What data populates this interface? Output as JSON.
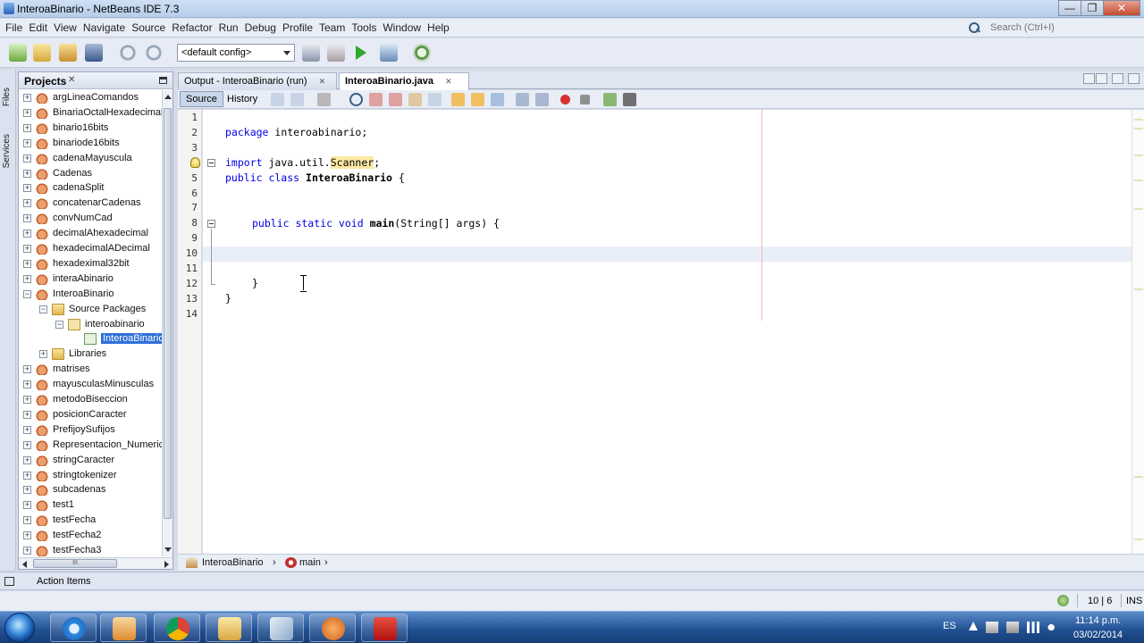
{
  "window": {
    "title": "InteroaBinario - NetBeans IDE 7.3",
    "controls": {
      "minimize": "—",
      "maximize": "❐",
      "close": "✕"
    }
  },
  "menubar": {
    "items": [
      "File",
      "Edit",
      "View",
      "Navigate",
      "Source",
      "Refactor",
      "Run",
      "Debug",
      "Profile",
      "Team",
      "Tools",
      "Window",
      "Help"
    ],
    "search_placeholder": "Search (Ctrl+I)"
  },
  "toolbar": {
    "config_value": "<default config>"
  },
  "side_strip": {
    "files_label": "Files",
    "services_label": "Services"
  },
  "projects": {
    "title": "Projects",
    "close_glyph": "✕",
    "rows": [
      {
        "label": "argLineaComandos",
        "expander": "+",
        "icon": "project-icon",
        "indent": 0
      },
      {
        "label": "BinariaOctalHexadecimal",
        "expander": "+",
        "icon": "project-icon",
        "indent": 0
      },
      {
        "label": "binario16bits",
        "expander": "+",
        "icon": "project-icon",
        "indent": 0
      },
      {
        "label": "binariode16bits",
        "expander": "+",
        "icon": "project-icon",
        "indent": 0
      },
      {
        "label": "cadenaMayuscula",
        "expander": "+",
        "icon": "project-icon",
        "indent": 0
      },
      {
        "label": "Cadenas",
        "expander": "+",
        "icon": "project-icon",
        "indent": 0
      },
      {
        "label": "cadenaSplit",
        "expander": "+",
        "icon": "project-icon",
        "indent": 0
      },
      {
        "label": "concatenarCadenas",
        "expander": "+",
        "icon": "project-icon",
        "indent": 0
      },
      {
        "label": "convNumCad",
        "expander": "+",
        "icon": "project-icon",
        "indent": 0
      },
      {
        "label": "decimalAhexadecimal",
        "expander": "+",
        "icon": "project-icon",
        "indent": 0
      },
      {
        "label": "hexadecimalADecimal",
        "expander": "+",
        "icon": "project-icon",
        "indent": 0
      },
      {
        "label": "hexadeximal32bit",
        "expander": "+",
        "icon": "project-icon",
        "indent": 0
      },
      {
        "label": "interaAbinario",
        "expander": "+",
        "icon": "project-icon",
        "indent": 0
      },
      {
        "label": "InteroaBinario",
        "expander": "−",
        "icon": "project-icon",
        "indent": 0
      },
      {
        "label": "Source Packages",
        "expander": "−",
        "icon": "source-packages-icon",
        "indent": 1
      },
      {
        "label": "interoabinario",
        "expander": "−",
        "icon": "package-icon",
        "indent": 2
      },
      {
        "label": "InteroaBinario.java",
        "expander": "",
        "icon": "java-file-icon",
        "indent": 3,
        "selected": true
      },
      {
        "label": "Libraries",
        "expander": "+",
        "icon": "libraries-icon",
        "indent": 1
      },
      {
        "label": "matrises",
        "expander": "+",
        "icon": "project-icon",
        "indent": 0
      },
      {
        "label": "mayusculasMinusculas",
        "expander": "+",
        "icon": "project-icon",
        "indent": 0
      },
      {
        "label": "metodoBiseccion",
        "expander": "+",
        "icon": "project-icon",
        "indent": 0
      },
      {
        "label": "posicionCaracter",
        "expander": "+",
        "icon": "project-icon",
        "indent": 0
      },
      {
        "label": "PrefijoySufijos",
        "expander": "+",
        "icon": "project-icon",
        "indent": 0
      },
      {
        "label": "Representacion_Numerica",
        "expander": "+",
        "icon": "project-icon",
        "indent": 0
      },
      {
        "label": "stringCaracter",
        "expander": "+",
        "icon": "project-icon",
        "indent": 0
      },
      {
        "label": "stringtokenizer",
        "expander": "+",
        "icon": "project-icon",
        "indent": 0
      },
      {
        "label": "subcadenas",
        "expander": "+",
        "icon": "project-icon",
        "indent": 0
      },
      {
        "label": "test1",
        "expander": "+",
        "icon": "project-icon",
        "indent": 0
      },
      {
        "label": "testFecha",
        "expander": "+",
        "icon": "project-icon",
        "indent": 0
      },
      {
        "label": "testFecha2",
        "expander": "+",
        "icon": "project-icon",
        "indent": 0
      },
      {
        "label": "testFecha3",
        "expander": "+",
        "icon": "project-icon",
        "indent": 0
      }
    ],
    "hscroll_grip": "III"
  },
  "editor": {
    "tabs": [
      {
        "label": "Output - InteroaBinario (run)",
        "active": false,
        "close": "✕"
      },
      {
        "label": "InteroaBinario.java",
        "active": true,
        "close": "✕"
      }
    ],
    "view_buttons": {
      "source": "Source",
      "history": "History"
    },
    "line_numbers": [
      "1",
      "2",
      "3",
      "4",
      "5",
      "6",
      "7",
      "8",
      "9",
      "10",
      "11",
      "12",
      "13",
      "14"
    ],
    "code": {
      "l2_kw": "package",
      "l2_rest": " interoabinario;",
      "l4_kw": "import",
      "l4_mid": " java.util.",
      "l4_hl": "Scanner",
      "l4_end": ";",
      "l5_kw": "public class",
      "l5_sp": " ",
      "l5_name": "InteroaBinario",
      "l5_end": " {",
      "l8_kw": "public static void",
      "l8_sp": " ",
      "l8_name": "main",
      "l8_rest": "(String[] args) {",
      "l12": "}",
      "l13": "}"
    }
  },
  "navigator_bar": {
    "class_crumb": "InteroaBinario",
    "method_crumb": "main",
    "sep": "›"
  },
  "bottom": {
    "action_items": "Action Items",
    "caret_position": "10 | 6",
    "insert_mode": "INS"
  },
  "taskbar": {
    "language": "ES",
    "time": "11:14 p.m.",
    "date": "03/02/2014"
  }
}
